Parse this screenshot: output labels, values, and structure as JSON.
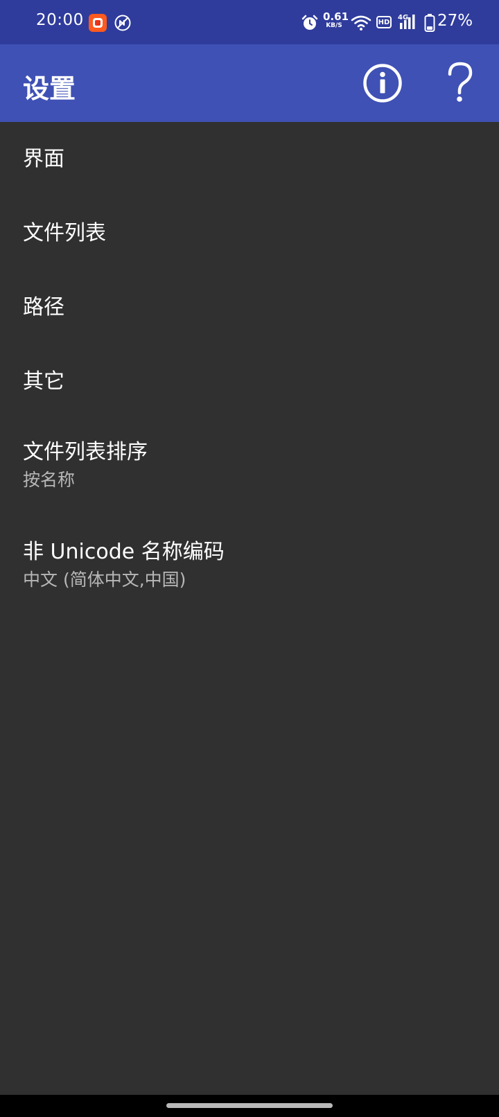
{
  "status_bar": {
    "time": "20:00",
    "net_speed_value": "0.61",
    "net_speed_unit": "KB/S",
    "hd_label": "HD",
    "network_type": "4G",
    "battery_percent": "27%",
    "battery_level": 0.27,
    "icons": [
      "app-notification-icon",
      "nfc-off-icon",
      "alarm-icon",
      "wifi-icon",
      "hd-icon",
      "signal-icon",
      "battery-icon"
    ]
  },
  "app_bar": {
    "title": "设置",
    "background": "#3f51b5",
    "actions": [
      "info-icon",
      "help-icon"
    ]
  },
  "settings": {
    "items": [
      {
        "title": "界面"
      },
      {
        "title": "文件列表"
      },
      {
        "title": "路径"
      },
      {
        "title": "其它"
      },
      {
        "title": "文件列表排序",
        "summary": "按名称"
      },
      {
        "title": "非 Unicode 名称编码",
        "summary": "中文 (简体中文,中国)"
      }
    ]
  },
  "colors": {
    "status_bar": "#2f3c9c",
    "background": "#303030",
    "text_primary": "#ffffff",
    "text_secondary": "#b7b7b7"
  }
}
